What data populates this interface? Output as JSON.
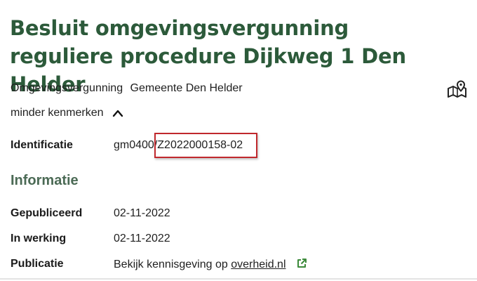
{
  "title": "Besluit omgevingsvergunning reguliere procedure Dijkweg 1 Den Helder",
  "meta": {
    "type": "Omgevingsvergunning",
    "organisation": "Gemeente Den Helder"
  },
  "toggle_label": "minder kenmerken",
  "identification": {
    "label": "Identificatie",
    "prefix": "gm0400/",
    "id": "Z2022000158-02"
  },
  "info": {
    "heading": "Informatie",
    "published_label": "Gepubliceerd",
    "published_value": "02-11-2022",
    "in_force_label": "In werking",
    "in_force_value": "02-11-2022",
    "publication_label": "Publicatie",
    "publication_text": "Bekijk kennisgeving op",
    "publication_link": "overheid.nl"
  },
  "colors": {
    "title": "#2c5a3a",
    "heading": "#4b6a55",
    "highlight": "#c0282d",
    "external_icon": "#3c8a3a"
  },
  "icons": [
    "map-pin-icon",
    "chevron-up-icon",
    "external-link-icon"
  ]
}
